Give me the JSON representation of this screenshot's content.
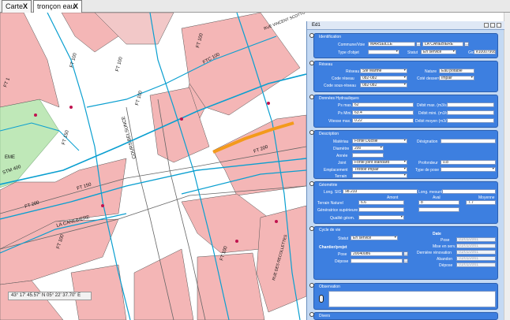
{
  "tabs": [
    {
      "label": "Carte",
      "close": "X"
    },
    {
      "label": "tronçon eau",
      "close": "X"
    }
  ],
  "map": {
    "coordinates": "43° 17' 45.57\" N 05° 22' 37.70\" E",
    "labels": {
      "ft100_a": "FT 100",
      "ft100_b": "FT 100",
      "ft150": "FT 150",
      "ftc100": "FTC 100",
      "ft100_c": "FT 100",
      "ft200_a": "FT 200",
      "ft150_b": "FT 150",
      "ft200_b": "FT 200",
      "ft100_d": "FT 100",
      "ft100_e": "FT 100",
      "lacanebiere": "LA CANEBIERE",
      "cours": "COURS BELSUNCE",
      "ft100_f": "FT 100",
      "rue_vincent": "RUE VINCENT SCOTTO",
      "rue_recollettes": "RUE DES RECOLLETTES",
      "eme": "EME",
      "stm": "STM 400",
      "ft1": "FT 1"
    }
  },
  "panel": {
    "title": "Ed1",
    "identification": {
      "title": "Identification",
      "commune_label": "Commune/Voie",
      "commune_value": "MARSEILLE",
      "voie_value": "LA CANEBIERE",
      "type_label": "Type d'objet",
      "statut_label": "Statut",
      "statut_value": "En service",
      "gid_label": "Gid",
      "gid_value": "e10007908"
    },
    "reseau": {
      "title": "Réseau",
      "reseau_label": "Réseau",
      "reseau_value": "Ste Marthe",
      "nature_label": "Nature",
      "nature_value": "Eau potable",
      "code_label": "Code réseau",
      "code_value": "082-082",
      "cote_label": "Coté desservi",
      "cote_value": "Impair",
      "code_sous_label": "Code sous-réseau",
      "code_sous_value": "082-082"
    },
    "hydro": {
      "title": "Données Hydrauliques",
      "pmax_label": "Ps max.",
      "pmax_value": "62",
      "pmin_label": "Ps Mini.",
      "pmin_value": "63.4",
      "vmax_label": "Vitesse max.",
      "vmax_value": "0.22",
      "dmax_label": "Débit max. (m3/s)",
      "dmin_label": "Débit mini. (m3/s)",
      "dmoy_label": "Débit moyen (m3/s)"
    },
    "description": {
      "title": "Description",
      "materiau_label": "Matériau",
      "materiau_value": "Fonte Ductile",
      "designation_label": "Désignation",
      "diametre_label": "Diamètre",
      "diametre_value": "200",
      "annee_label": "Année",
      "joint_label": "Joint",
      "joint_value": "Fonte joint standard",
      "profondeur_label": "Profondeur",
      "profondeur_value": "0.8",
      "emplacement_label": "Emplacement",
      "emplacement_value": "Trottoir impair",
      "typepose_label": "Type de pose",
      "terrain_label": "Terrain"
    },
    "geometrie": {
      "title": "Géométrie",
      "long_sig_label": "Long. SIG",
      "long_sig_value": "98.233",
      "long_mes_label": "Long. mesurée",
      "amont_label": "Amont",
      "aval_label": "Aval",
      "moyenne_label": "Moyenne",
      "terrain_label": "Terrain Naturel",
      "terrain_amont": "6.6",
      "terrain_aval": "8",
      "terrain_moy": "7.7",
      "gen_label": "Génératrice supérieure GS",
      "qualite_label": "Qualité géom."
    },
    "cycle": {
      "title": "Cycle de vie",
      "statut_label": "Statut",
      "statut_value": "En service",
      "dates_label": "Date",
      "pose_label": "Pose",
      "pose_date": "01/01/2001",
      "misenservice_label": "Mise en serv.",
      "misenservice_date": "01/01/2001",
      "renovation_label": "Dernière rénovation",
      "renovation_date": "01/01/2001",
      "abandon_label": "Abandon",
      "abandon_date": "01/01/2001",
      "depose_label": "Dépose",
      "depose_date": "01/01/2001",
      "chantier_label": "Chantier/projet",
      "chantier_pose_label": "Pose",
      "chantier_pose_value": "20040086",
      "chantier_depose_label": "Dépose"
    },
    "observation": {
      "title": "Observation"
    },
    "divers": {
      "title": "Divers"
    }
  }
}
